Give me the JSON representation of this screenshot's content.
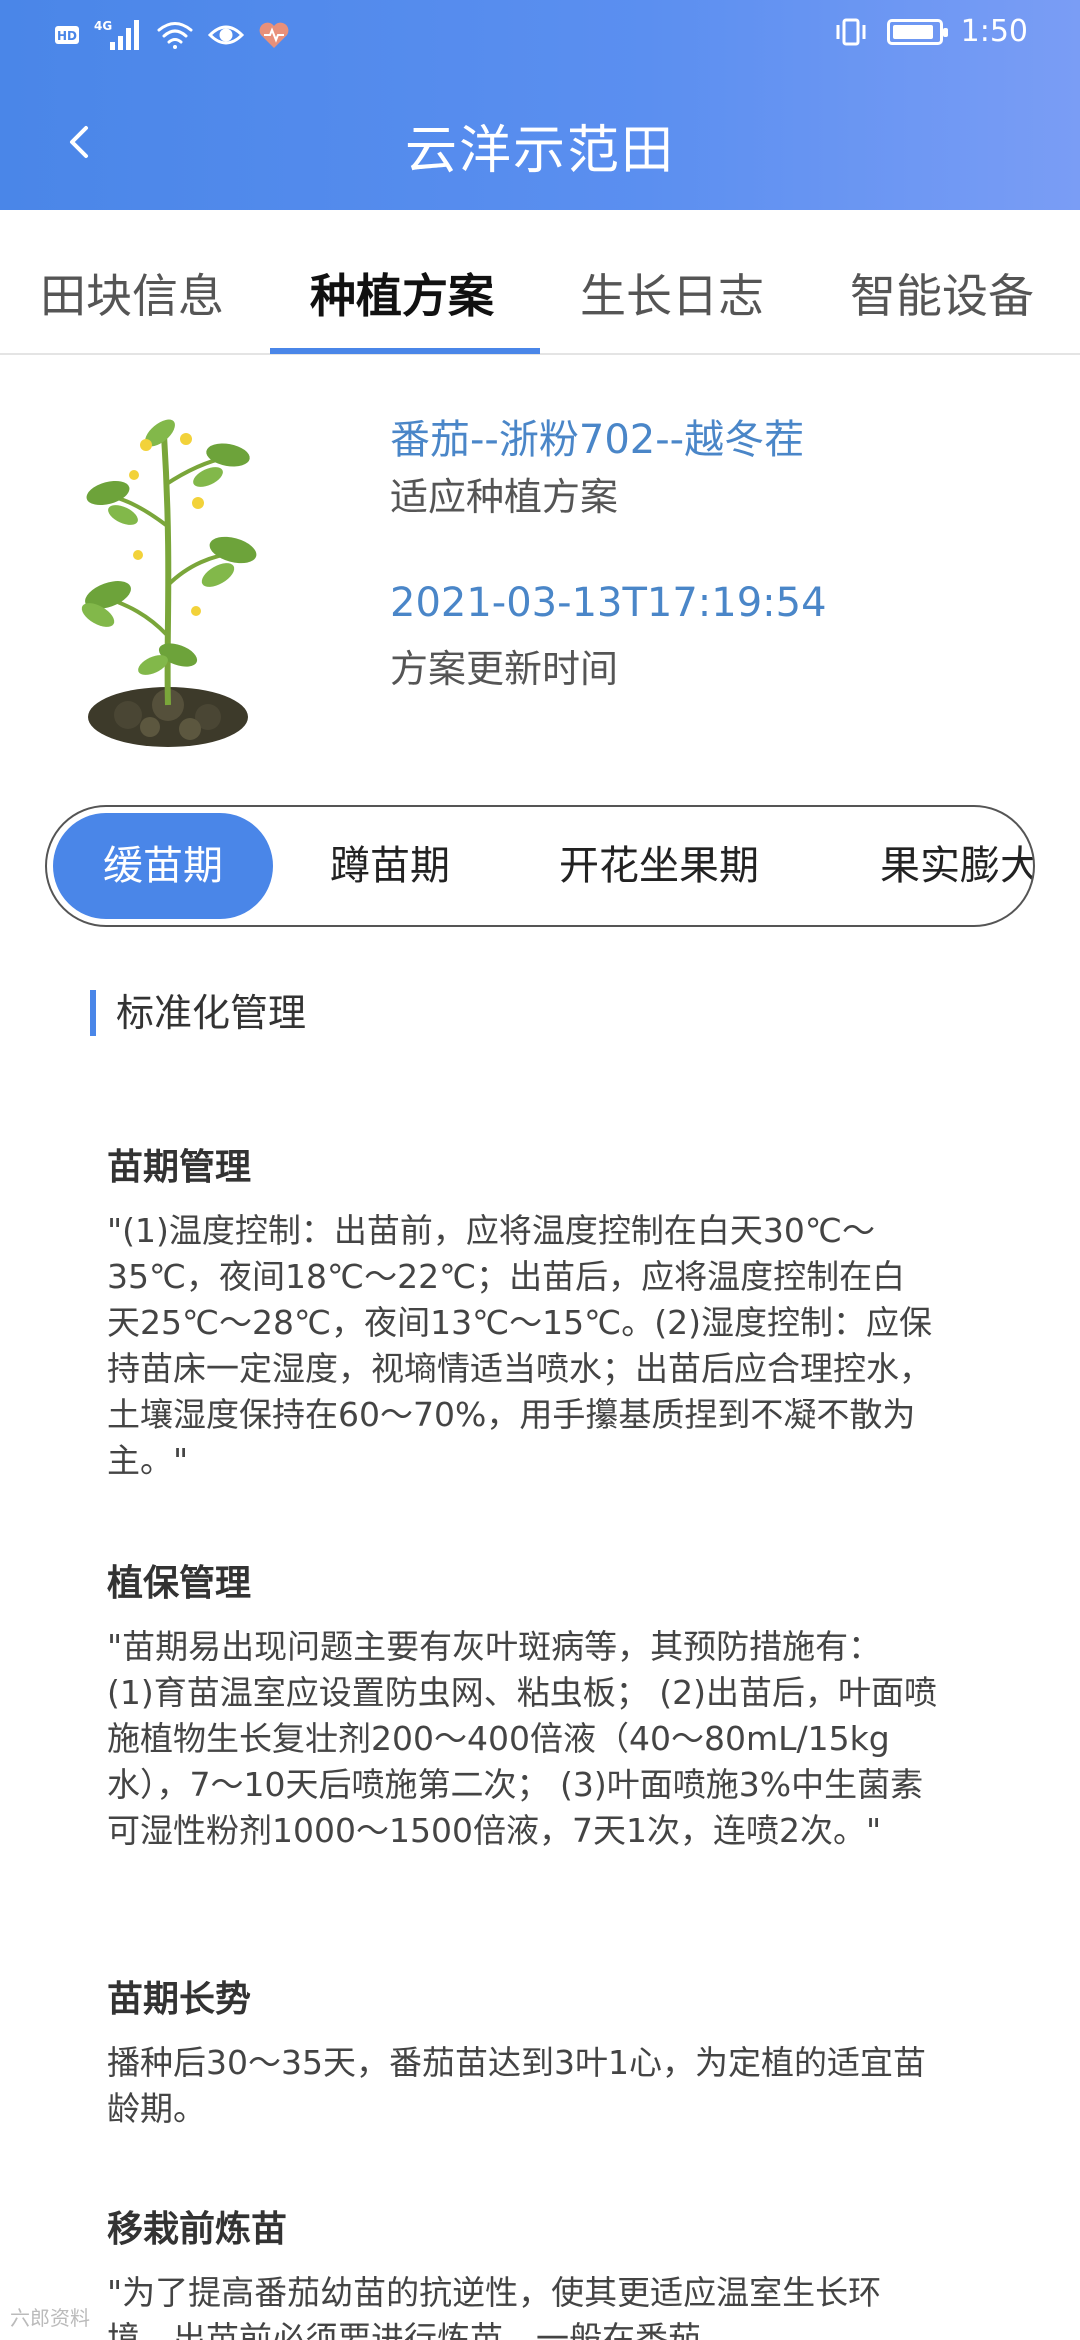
{
  "status_bar": {
    "left_icons": [
      "hd-icon",
      "4g-signal-icon",
      "wifi-icon",
      "eye-icon",
      "health-icon"
    ],
    "hd_text": "HD",
    "network_text": "4G",
    "time": "1:50",
    "battery_level": 0.9
  },
  "header": {
    "title": "云洋示范田"
  },
  "tabs": [
    {
      "label": "田块信息",
      "active": false
    },
    {
      "label": "种植方案",
      "active": true
    },
    {
      "label": "生长日志",
      "active": false
    },
    {
      "label": "智能设备",
      "active": false
    }
  ],
  "plan": {
    "name": "番茄--浙粉702--越冬茬",
    "name_caption": "适应种植方案",
    "update_time": "2021-03-13T17:19:54",
    "update_time_caption": "方案更新时间"
  },
  "stages": [
    {
      "label": "缓苗期",
      "active": true
    },
    {
      "label": "蹲苗期",
      "active": false
    },
    {
      "label": "开花坐果期",
      "active": false
    },
    {
      "label": "果实膨大",
      "active": false
    }
  ],
  "section_title": "标准化管理",
  "blocks": [
    {
      "title": "苗期管理",
      "text": "\"(1)温度控制：出苗前，应将温度控制在白天30℃～35℃，夜间18℃～22℃；出苗后，应将温度控制在白天25℃～28℃，夜间13℃～15℃。(2)湿度控制：应保持苗床一定湿度，视墒情适当喷水；出苗后应合理控水，土壤湿度保持在60～70%，用手攥基质捏到不凝不散为主。\""
    },
    {
      "title": "植保管理",
      "text": "\"苗期易出现问题主要有灰叶斑病等，其预防措施有： (1)育苗温室应设置防虫网、粘虫板； (2)出苗后，叶面喷施植物生长复壮剂200～400倍液（40～80mL/15kg水），7～10天后喷施第二次； (3)叶面喷施3%中生菌素可湿性粉剂1000～1500倍液，7天1次，连喷2次。\""
    },
    {
      "title": "苗期长势",
      "text": "播种后30～35天，番茄苗达到3叶1心，为定植的适宜苗龄期。"
    },
    {
      "title": "移栽前炼苗",
      "text": "\"为了提高番茄幼苗的抗逆性，使其更适应温室生长环境，出苗前必须要进行炼苗，一般在番茄"
    }
  ],
  "watermark": "六郎资料",
  "colors": {
    "accent": "#4a86e8",
    "link_text": "#4a86c8",
    "header_gradient_start": "#4a86e8",
    "header_gradient_end": "#7a9df5"
  }
}
